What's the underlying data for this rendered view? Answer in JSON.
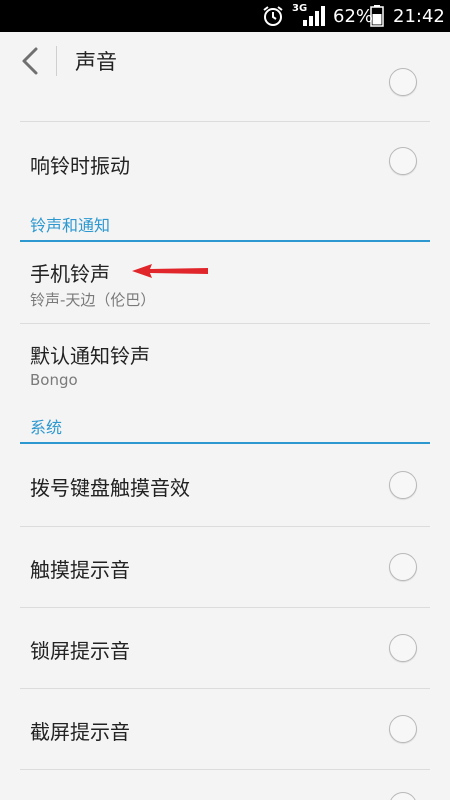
{
  "status_bar": {
    "network": "3G",
    "battery_percent": "62%",
    "time": "21:42",
    "icons": [
      "alarm-icon",
      "signal-icon",
      "battery-icon"
    ]
  },
  "app_bar": {
    "title": "声音",
    "back_icon": "back-chevron-icon"
  },
  "items": {
    "ring_vibrate": {
      "label": "响铃时振动",
      "checked": false
    },
    "phone_ringtone": {
      "label": "手机铃声",
      "value": "铃声-天边（伦巴）"
    },
    "default_notification": {
      "label": "默认通知铃声",
      "value": "Bongo"
    },
    "dial_pad": {
      "label": "拨号键盘触摸音效",
      "checked": false
    },
    "touch_sound": {
      "label": "触摸提示音",
      "checked": false
    },
    "lock_sound": {
      "label": "锁屏提示音",
      "checked": false
    },
    "screenshot_sound": {
      "label": "截屏提示音",
      "checked": false
    }
  },
  "sections": {
    "ringtones": "铃声和通知",
    "system": "系统"
  },
  "colors": {
    "accent": "#2d98d0",
    "annotation_arrow": "#e0262b"
  }
}
